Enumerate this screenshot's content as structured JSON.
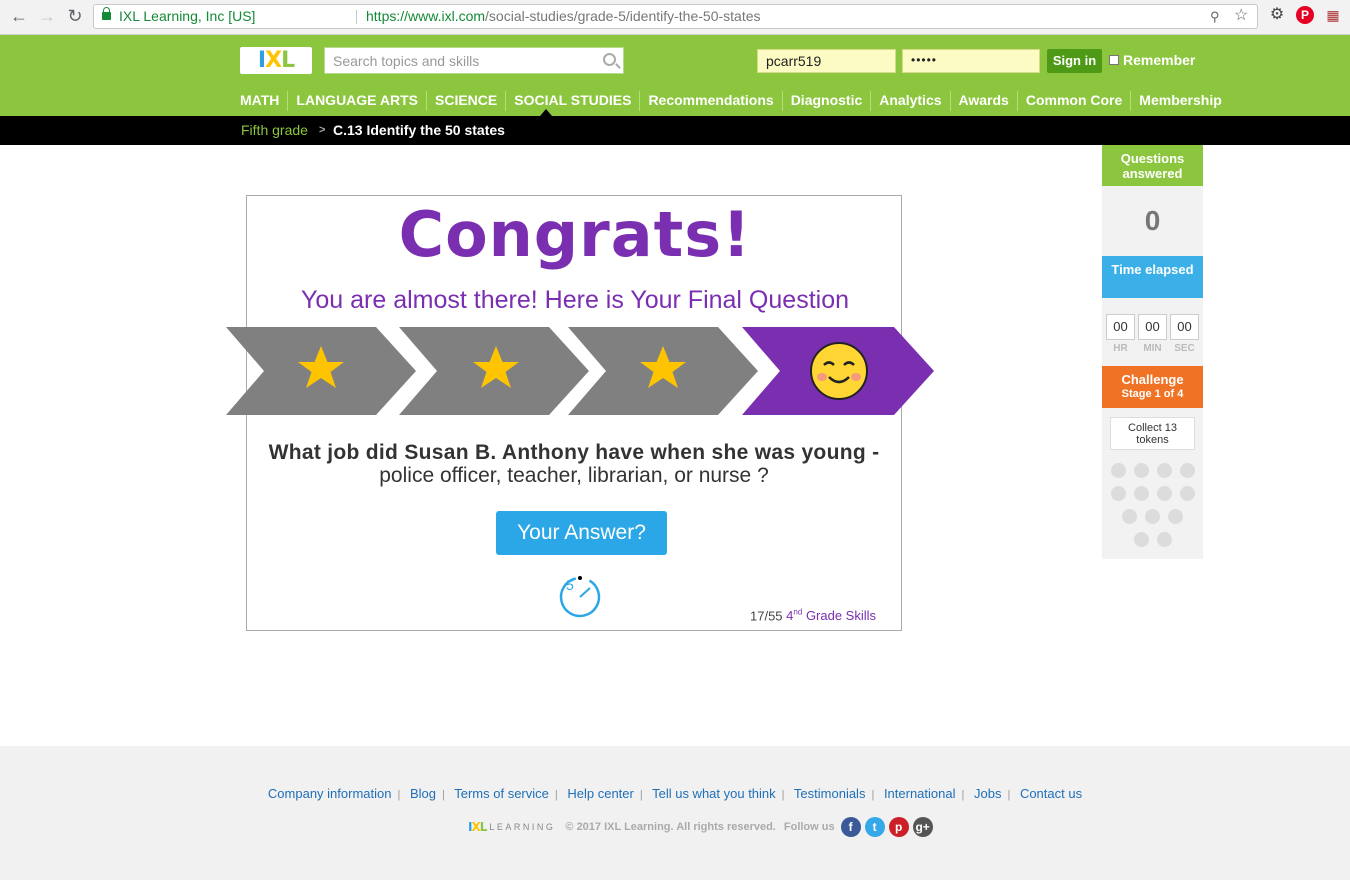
{
  "browser": {
    "site_identity": "IXL Learning, Inc [US]",
    "url_host": "https://www.ixl.com",
    "url_path": "/social-studies/grade-5/identify-the-50-states"
  },
  "header": {
    "logo_text": [
      "I",
      "X",
      "L"
    ],
    "search_placeholder": "Search topics and skills",
    "username": "pcarr519",
    "password_mask": "•••••",
    "signin_label": "Sign in",
    "remember_label": "Remember",
    "nav": [
      "MATH",
      "LANGUAGE ARTS",
      "SCIENCE",
      "SOCIAL STUDIES",
      "Recommendations",
      "Diagnostic",
      "Analytics",
      "Awards",
      "Common Core",
      "Membership"
    ],
    "active_nav": "SOCIAL STUDIES"
  },
  "breadcrumb": {
    "grade": "Fifth grade",
    "separator": ">",
    "skill": "C.13 Identify the 50 states"
  },
  "sidebar": {
    "questions_answered_label": "Questions answered",
    "questions_answered": "0",
    "time_elapsed_label": "Time elapsed",
    "hr": "00",
    "min": "00",
    "sec": "00",
    "hr_label": "HR",
    "min_label": "MIN",
    "sec_label": "SEC",
    "challenge_label": "Challenge",
    "challenge_stage": "Stage 1 of 4",
    "collect_tokens": "Collect 13 tokens",
    "token_count": 13
  },
  "card": {
    "title": "Congrats!",
    "subtitle": "You are almost there! Here is Your Final Question",
    "question_line1": "What job did Susan B. Anthony have when she was young -",
    "question_line2": "police officer, teacher, librarian, or nurse ?",
    "answer_button": "Your Answer?",
    "countdown": "5",
    "progress_count": "17/55",
    "progress_grade_num": "4",
    "progress_grade_sup": "nd",
    "progress_grade_text": "Grade Skills"
  },
  "colors": {
    "brand_green": "#8cc63e",
    "purple": "#7a2fb1",
    "blue": "#2ba6e6",
    "orange": "#ef7225",
    "star_yellow": "#ffc400",
    "chevron_gray": "#808080"
  },
  "footer": {
    "links": [
      "Company information",
      "Blog",
      "Terms of service",
      "Help center",
      "Tell us what you think",
      "Testimonials",
      "International",
      "Jobs",
      "Contact us"
    ],
    "logo_text": [
      "I",
      "X",
      "L"
    ],
    "learning": "LEARNING",
    "copyright": "© 2017 IXL Learning. All rights reserved.",
    "follow_us": "Follow us",
    "social": [
      {
        "name": "facebook-icon",
        "glyph": "f",
        "color": "#3b5998"
      },
      {
        "name": "twitter-icon",
        "glyph": "t",
        "color": "#35a9e7"
      },
      {
        "name": "pinterest-icon",
        "glyph": "p",
        "color": "#cb2027"
      },
      {
        "name": "google-plus-icon",
        "glyph": "g+",
        "color": "#555"
      }
    ]
  }
}
